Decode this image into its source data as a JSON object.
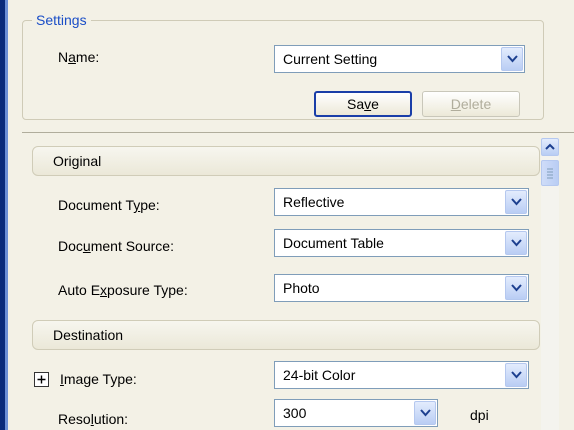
{
  "settings": {
    "legend": "Settings",
    "name_label_pre": "N",
    "name_label_u": "a",
    "name_label_post": "me:",
    "name_value": "Current Setting",
    "save_pre": "Sa",
    "save_u": "v",
    "save_post": "e",
    "delete_u": "D",
    "delete_post": "elete"
  },
  "original": {
    "title": "Original",
    "doc_type_pre": "Document T",
    "doc_type_u": "y",
    "doc_type_post": "pe:",
    "doc_type_value": "Reflective",
    "doc_source_pre": "Doc",
    "doc_source_u": "u",
    "doc_source_post": "ment Source:",
    "doc_source_value": "Document Table",
    "auto_exp_pre": "Auto E",
    "auto_exp_u": "x",
    "auto_exp_post": "posure Type:",
    "auto_exp_value": "Photo"
  },
  "destination": {
    "title": "Destination",
    "image_type_u": "I",
    "image_type_post": "mage Type:",
    "image_type_value": "24-bit Color",
    "resolution_pre": "Reso",
    "resolution_u": "l",
    "resolution_post": "ution:",
    "resolution_value": "300",
    "resolution_unit": "dpi"
  },
  "colors": {
    "legend": "#1a4ec7",
    "background": "#f3f1e6",
    "combo_border": "#7f9db9"
  },
  "icons": [
    "chevron-down-icon",
    "chevron-up-icon",
    "plus-icon"
  ]
}
